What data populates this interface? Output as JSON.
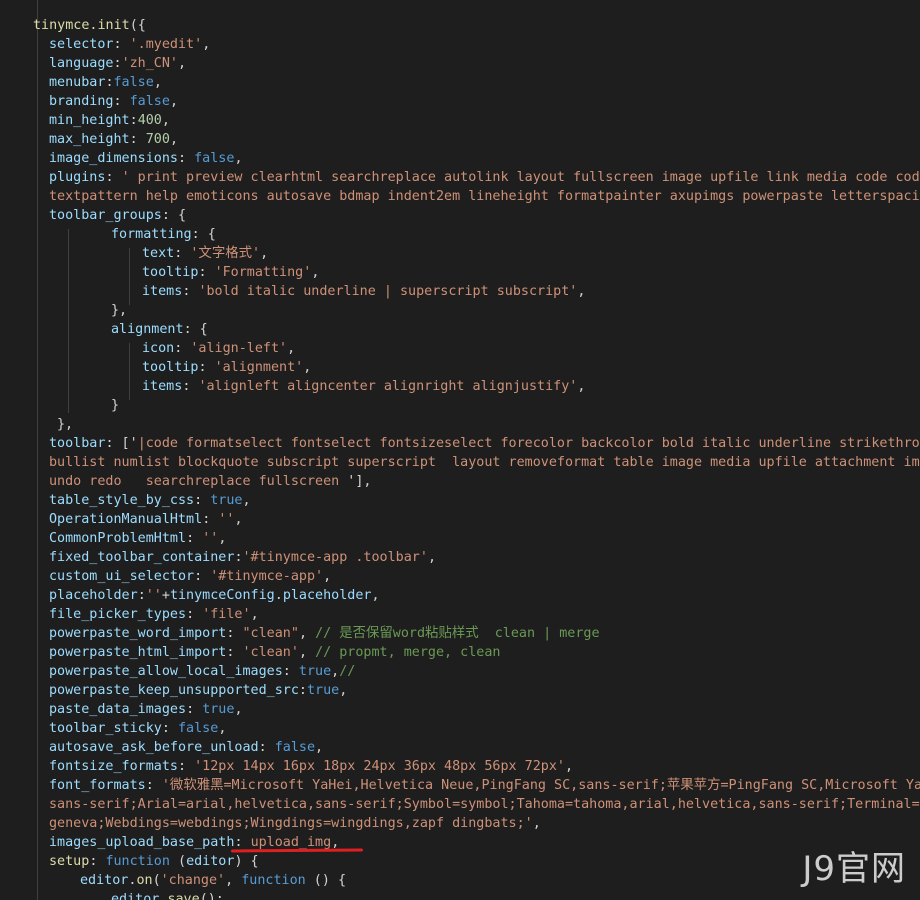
{
  "editor": {
    "theme_colors": {
      "background": "#1e1e1e",
      "identifier": "#9cdcfe",
      "function": "#dcdcaa",
      "string": "#ce9178",
      "keyword": "#569cd6",
      "number": "#b5cea8",
      "comment": "#6a9955",
      "punctuation": "#d4d4d4"
    },
    "lines": [
      [
        [
          "func",
          "tinymce.init"
        ],
        [
          "default",
          "({"
        ]
      ],
      [
        [
          "ident",
          "selector"
        ],
        [
          "default",
          ": "
        ],
        [
          "string",
          "'.myedit'"
        ],
        [
          "default",
          ","
        ]
      ],
      [
        [
          "ident",
          "language"
        ],
        [
          "default",
          ":"
        ],
        [
          "string",
          "'zh_CN'"
        ],
        [
          "default",
          ","
        ]
      ],
      [
        [
          "ident",
          "menubar"
        ],
        [
          "default",
          ":"
        ],
        [
          "keyword",
          "false"
        ],
        [
          "default",
          ","
        ]
      ],
      [
        [
          "ident",
          "branding"
        ],
        [
          "default",
          ": "
        ],
        [
          "keyword",
          "false"
        ],
        [
          "default",
          ","
        ]
      ],
      [
        [
          "ident",
          "min_height"
        ],
        [
          "default",
          ":"
        ],
        [
          "number",
          "400"
        ],
        [
          "default",
          ","
        ]
      ],
      [
        [
          "ident",
          "max_height"
        ],
        [
          "default",
          ": "
        ],
        [
          "number",
          "700"
        ],
        [
          "default",
          ","
        ]
      ],
      [
        [
          "ident",
          "image_dimensions"
        ],
        [
          "default",
          ": "
        ],
        [
          "keyword",
          "false"
        ],
        [
          "default",
          ","
        ]
      ],
      [
        [
          "ident",
          "plugins"
        ],
        [
          "default",
          ": "
        ],
        [
          "string",
          "' print preview clearhtml searchreplace autolink layout fullscreen image upfile link media code codesample"
        ]
      ],
      [
        [
          "string",
          "textpattern help emoticons autosave bdmap indent2em lineheight formatpainter axupimgs powerpaste letterspacing imagetools"
        ]
      ],
      [
        [
          "ident",
          "toolbar_groups"
        ],
        [
          "default",
          ": {"
        ]
      ],
      [
        [
          "ident",
          "formatting"
        ],
        [
          "default",
          ": {"
        ]
      ],
      [
        [
          "ident",
          "text"
        ],
        [
          "default",
          ": "
        ],
        [
          "string",
          "'文字格式'"
        ],
        [
          "default",
          ","
        ]
      ],
      [
        [
          "ident",
          "tooltip"
        ],
        [
          "default",
          ": "
        ],
        [
          "string",
          "'Formatting'"
        ],
        [
          "default",
          ","
        ]
      ],
      [
        [
          "ident",
          "items"
        ],
        [
          "default",
          ": "
        ],
        [
          "string",
          "'bold italic underline | superscript subscript'"
        ],
        [
          "default",
          ","
        ]
      ],
      [
        [
          "default",
          "},"
        ]
      ],
      [
        [
          "ident",
          "alignment"
        ],
        [
          "default",
          ": {"
        ]
      ],
      [
        [
          "ident",
          "icon"
        ],
        [
          "default",
          ": "
        ],
        [
          "string",
          "'align-left'"
        ],
        [
          "default",
          ","
        ]
      ],
      [
        [
          "ident",
          "tooltip"
        ],
        [
          "default",
          ": "
        ],
        [
          "string",
          "'alignment'"
        ],
        [
          "default",
          ","
        ]
      ],
      [
        [
          "ident",
          "items"
        ],
        [
          "default",
          ": "
        ],
        [
          "string",
          "'alignleft aligncenter alignright alignjustify'"
        ],
        [
          "default",
          ","
        ]
      ],
      [
        [
          "default",
          "}"
        ]
      ],
      [
        [
          "default",
          "},"
        ]
      ],
      [
        [
          "ident",
          "toolbar"
        ],
        [
          "default",
          ": ['"
        ],
        [
          "string",
          "|code formatselect fontselect fontsizeselect forecolor backcolor bold italic underline strikethrough link"
        ]
      ],
      [
        [
          "string",
          "bullist numlist blockquote subscript superscript  layout removeformat table image media upfile attachment importword"
        ]
      ],
      [
        [
          "string",
          "undo redo   searchreplace fullscreen "
        ],
        [
          "default",
          "'],"
        ]
      ],
      [
        [
          "ident",
          "table_style_by_css"
        ],
        [
          "default",
          ": "
        ],
        [
          "keyword",
          "true"
        ],
        [
          "default",
          ","
        ]
      ],
      [
        [
          "ident",
          "OperationManualHtml"
        ],
        [
          "default",
          ": "
        ],
        [
          "string",
          "''"
        ],
        [
          "default",
          ","
        ]
      ],
      [
        [
          "ident",
          "CommonProblemHtml"
        ],
        [
          "default",
          ": "
        ],
        [
          "string",
          "''"
        ],
        [
          "default",
          ","
        ]
      ],
      [
        [
          "ident",
          "fixed_toolbar_container"
        ],
        [
          "default",
          ":"
        ],
        [
          "string",
          "'#tinymce-app .toolbar'"
        ],
        [
          "default",
          ","
        ]
      ],
      [
        [
          "ident",
          "custom_ui_selector"
        ],
        [
          "default",
          ": "
        ],
        [
          "string",
          "'#tinymce-app'"
        ],
        [
          "default",
          ","
        ]
      ],
      [
        [
          "ident",
          "placeholder"
        ],
        [
          "default",
          ":"
        ],
        [
          "string",
          "''"
        ],
        [
          "default",
          "+"
        ],
        [
          "ident",
          "tinymceConfig"
        ],
        [
          "default",
          "."
        ],
        [
          "ident",
          "placeholder"
        ],
        [
          "default",
          ","
        ]
      ],
      [
        [
          "ident",
          "file_picker_types"
        ],
        [
          "default",
          ": "
        ],
        [
          "string",
          "'file'"
        ],
        [
          "default",
          ","
        ]
      ],
      [
        [
          "ident",
          "powerpaste_word_import"
        ],
        [
          "default",
          ": "
        ],
        [
          "string",
          "\"clean\""
        ],
        [
          "default",
          ", "
        ],
        [
          "comment",
          "// 是否保留word粘贴样式  clean | merge"
        ]
      ],
      [
        [
          "ident",
          "powerpaste_html_import"
        ],
        [
          "default",
          ": "
        ],
        [
          "string",
          "'clean'"
        ],
        [
          "default",
          ", "
        ],
        [
          "comment",
          "// propmt, merge, clean"
        ]
      ],
      [
        [
          "ident",
          "powerpaste_allow_local_images"
        ],
        [
          "default",
          ": "
        ],
        [
          "keyword",
          "true"
        ],
        [
          "default",
          ","
        ],
        [
          "comment",
          "//"
        ]
      ],
      [
        [
          "ident",
          "powerpaste_keep_unsupported_src"
        ],
        [
          "default",
          ":"
        ],
        [
          "keyword",
          "true"
        ],
        [
          "default",
          ","
        ]
      ],
      [
        [
          "ident",
          "paste_data_images"
        ],
        [
          "default",
          ": "
        ],
        [
          "keyword",
          "true"
        ],
        [
          "default",
          ","
        ]
      ],
      [
        [
          "ident",
          "toolbar_sticky"
        ],
        [
          "default",
          ": "
        ],
        [
          "keyword",
          "false"
        ],
        [
          "default",
          ","
        ]
      ],
      [
        [
          "ident",
          "autosave_ask_before_unload"
        ],
        [
          "default",
          ": "
        ],
        [
          "keyword",
          "false"
        ],
        [
          "default",
          ","
        ]
      ],
      [
        [
          "ident",
          "fontsize_formats"
        ],
        [
          "default",
          ": "
        ],
        [
          "string",
          "'12px 14px 16px 18px 24px 36px 48px 56px 72px'"
        ],
        [
          "default",
          ","
        ]
      ],
      [
        [
          "ident",
          "font_formats"
        ],
        [
          "default",
          ": "
        ],
        [
          "string",
          "'微软雅黑=Microsoft YaHei,Helvetica Neue,PingFang SC,sans-serif;苹果苹方=PingFang SC,Microsoft YaHei,"
        ]
      ],
      [
        [
          "string",
          "sans-serif;Arial=arial,helvetica,sans-serif;Symbol=symbol;Tahoma=tahoma,arial,helvetica,sans-serif;Terminal=terminal,monaco;"
        ]
      ],
      [
        [
          "string",
          "geneva;Webdings=webdings;Wingdings=wingdings,zapf dingbats;'"
        ],
        [
          "default",
          ","
        ]
      ],
      [
        [
          "ident",
          "images_upload_base_path"
        ],
        [
          "default",
          ": "
        ],
        [
          "string",
          "upload_img"
        ],
        [
          "default",
          ","
        ]
      ],
      [
        [
          "func",
          "setup"
        ],
        [
          "default",
          ": "
        ],
        [
          "keyword",
          "function"
        ],
        [
          "default",
          " ("
        ],
        [
          "ident",
          "editor"
        ],
        [
          "default",
          ") {"
        ]
      ],
      [
        [
          "ident",
          "editor"
        ],
        [
          "default",
          "."
        ],
        [
          "func",
          "on"
        ],
        [
          "default",
          "("
        ],
        [
          "string",
          "'change'"
        ],
        [
          "default",
          ", "
        ],
        [
          "keyword",
          "function"
        ],
        [
          "default",
          " () {"
        ]
      ],
      [
        [
          "ident",
          "editor"
        ],
        [
          "default",
          "."
        ],
        [
          "func",
          "save"
        ],
        [
          "default",
          "();"
        ]
      ]
    ]
  },
  "watermark": {
    "text": "J9官网"
  }
}
